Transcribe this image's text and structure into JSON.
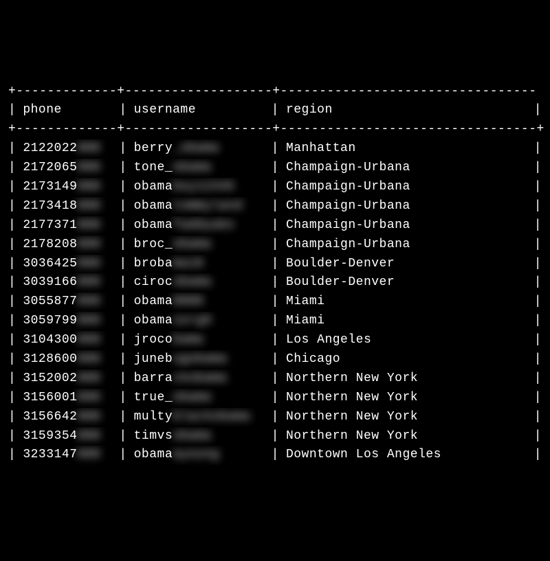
{
  "headers": {
    "phone": "phone",
    "username": "username",
    "region": "region"
  },
  "dividers": {
    "seg_phone": "+------------",
    "seg_username": "+-----------------",
    "seg_region": "+--------------------------------+",
    "seg_region_wide": "+-------------------------------- "
  },
  "rows": [
    {
      "phone_visible": "2122022",
      "phone_redacted": "000",
      "username_visible": "berry",
      "username_redacted": "_obama",
      "region": "Manhattan"
    },
    {
      "phone_visible": "2172065",
      "phone_redacted": "000",
      "username_visible": "tone_",
      "username_redacted": "obama",
      "region": "Champaign-Urbana"
    },
    {
      "phone_visible": "2173149",
      "phone_redacted": "000",
      "username_visible": "obama",
      "username_redacted": "boy12345",
      "region": "Champaign-Urbana"
    },
    {
      "phone_visible": "2173418",
      "phone_redacted": "000",
      "username_visible": "obama",
      "username_redacted": "tommyland",
      "region": "Champaign-Urbana"
    },
    {
      "phone_visible": "2177371",
      "phone_redacted": "000",
      "username_visible": "obama",
      "username_redacted": "faddyabs",
      "region": "Champaign-Urbana"
    },
    {
      "phone_visible": "2178208",
      "phone_redacted": "000",
      "username_visible": "broc_",
      "username_redacted": "obama",
      "region": "Champaign-Urbana"
    },
    {
      "phone_visible": "3036425",
      "phone_redacted": "000",
      "username_visible": "broba",
      "username_redacted": "ma18",
      "region": "Boulder-Denver"
    },
    {
      "phone_visible": "3039166",
      "phone_redacted": "000",
      "username_visible": "ciroc",
      "username_redacted": "obama",
      "region": "Boulder-Denver"
    },
    {
      "phone_visible": "3055877",
      "phone_redacted": "000",
      "username_visible": "obama",
      "username_redacted": "0808",
      "region": "Miami"
    },
    {
      "phone_visible": "3059799",
      "phone_redacted": "000",
      "username_visible": "obama",
      "username_redacted": "sorg9",
      "region": "Miami"
    },
    {
      "phone_visible": "3104300",
      "phone_redacted": "000",
      "username_visible": "jroco",
      "username_redacted": "bama",
      "region": "Los Angeles"
    },
    {
      "phone_visible": "3128600",
      "phone_redacted": "000",
      "username_visible": "juneb",
      "username_redacted": "ugobama",
      "region": "Chicago"
    },
    {
      "phone_visible": "3152002",
      "phone_redacted": "000",
      "username_visible": "barra",
      "username_redacted": "ckobama",
      "region": "Northern New York"
    },
    {
      "phone_visible": "3156001",
      "phone_redacted": "000",
      "username_visible": "true_",
      "username_redacted": "obama",
      "region": "Northern New York"
    },
    {
      "phone_visible": "3156642",
      "phone_redacted": "000",
      "username_visible": "multy",
      "username_redacted": "blackobama",
      "region": "Northern New York"
    },
    {
      "phone_visible": "3159354",
      "phone_redacted": "000",
      "username_visible": "timvs",
      "username_redacted": "obama",
      "region": "Northern New York"
    },
    {
      "phone_visible": "3233147",
      "phone_redacted": "000",
      "username_visible": "obama",
      "username_redacted": "ayoung",
      "region": "Downtown Los Angeles"
    }
  ]
}
